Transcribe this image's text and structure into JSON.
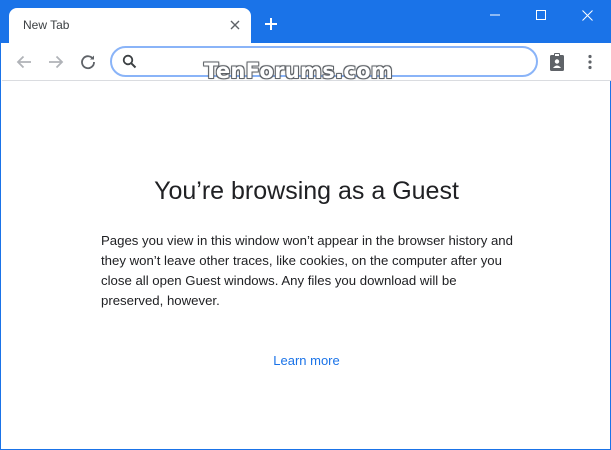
{
  "browser": {
    "tab_title": "New Tab",
    "omnibox_value": "",
    "omnibox_placeholder": "",
    "accent_color": "#1a73e8"
  },
  "watermark": "TenForums.com",
  "content": {
    "heading": "You’re browsing as a Guest",
    "body": "Pages you view in this window won’t appear in the browser history and they won’t leave other traces, like cookies, on the computer after you close all open Guest windows. Any files you download will be preserved, however.",
    "link": "Learn more"
  },
  "icons": [
    "close-icon",
    "plus-icon",
    "minimize-icon",
    "maximize-icon",
    "window-close-icon",
    "back-arrow-icon",
    "forward-arrow-icon",
    "reload-icon",
    "search-icon",
    "clipboard-profile-icon",
    "more-menu-icon"
  ]
}
